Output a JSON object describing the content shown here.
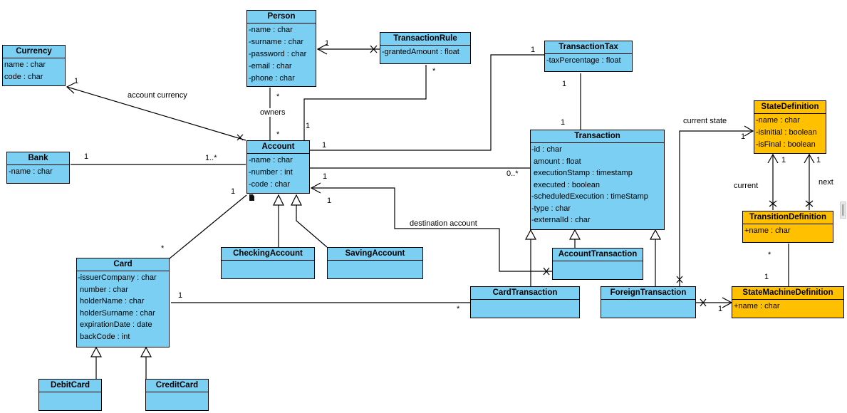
{
  "diagram": {
    "type": "UML class diagram",
    "colors": {
      "entity_fill": "#7acff3",
      "state_fill": "#ffc000",
      "line": "#000000"
    },
    "classes": {
      "currency": {
        "name": "Currency",
        "attributes": [
          "name : char",
          "code : char"
        ]
      },
      "person": {
        "name": "Person",
        "attributes": [
          "-name : char",
          "-surname : char",
          "-password : char",
          "-email : char",
          "-phone : char"
        ]
      },
      "transaction_rule": {
        "name": "TransactionRule",
        "attributes": [
          "-grantedAmount : float"
        ]
      },
      "transaction_tax": {
        "name": "TransactionTax",
        "attributes": [
          "-taxPercentage : float"
        ]
      },
      "bank": {
        "name": "Bank",
        "attributes": [
          "-name : char"
        ]
      },
      "account": {
        "name": "Account",
        "attributes": [
          "-name : char",
          "-number : int",
          "-code : char"
        ]
      },
      "transaction": {
        "name": "Transaction",
        "attributes": [
          "-id : char",
          " amount : float",
          " executionStamp : timestamp",
          " executed : boolean",
          "-scheduledExecution : timeStamp",
          "-type : char",
          "-externalId : char"
        ]
      },
      "state_definition": {
        "name": "StateDefinition",
        "attributes": [
          "-name : char",
          "-isInitial : boolean",
          "-isFinal : boolean"
        ]
      },
      "transition_definition": {
        "name": "TransitionDefinition",
        "attributes": [
          "+name : char"
        ]
      },
      "state_machine_definition": {
        "name": "StateMachineDefinition",
        "attributes": [
          "+name : char"
        ]
      },
      "checking_account": {
        "name": "CheckingAccount",
        "attributes": []
      },
      "saving_account": {
        "name": "SavingAccount",
        "attributes": []
      },
      "account_transaction": {
        "name": "AccountTransaction",
        "attributes": []
      },
      "card_transaction": {
        "name": "CardTransaction",
        "attributes": []
      },
      "foreign_transaction": {
        "name": "ForeignTransaction",
        "attributes": []
      },
      "card": {
        "name": "Card",
        "attributes": [
          "-issuerCompany : char",
          " number : char",
          " holderName : char",
          " holderSurname : char",
          " expirationDate : date",
          " backCode : int"
        ]
      },
      "debit_card": {
        "name": "DebitCard",
        "attributes": []
      },
      "credit_card": {
        "name": "CreditCard",
        "attributes": []
      }
    },
    "association_labels": {
      "account_currency": "account currency",
      "owners": "owners",
      "destination_account": "destination account",
      "current_state": "current state",
      "current": "current",
      "next": "next"
    },
    "multiplicities": {
      "currency_end": "1",
      "person_rule_person": "1",
      "person_owners": "*",
      "account_owners": "*",
      "rule_star": "*",
      "account_rule": "1",
      "tax_account": "1",
      "account_tax": "1",
      "tax_transaction": "1",
      "transaction_tax": "1",
      "bank_end": "1",
      "account_bank": "1..*",
      "account_transaction": "1",
      "transaction_account": "0..*",
      "dest_upper": "1",
      "dest_lower": "1",
      "account_card": "1",
      "card_account": "*",
      "card_cardtx": "1",
      "cardtx_card": "*",
      "state_current": "1",
      "state_current_arrow": "1",
      "state_next_arrow": "1",
      "transition_star": "*",
      "smd_one": "1",
      "smd_arrow": "1"
    }
  }
}
